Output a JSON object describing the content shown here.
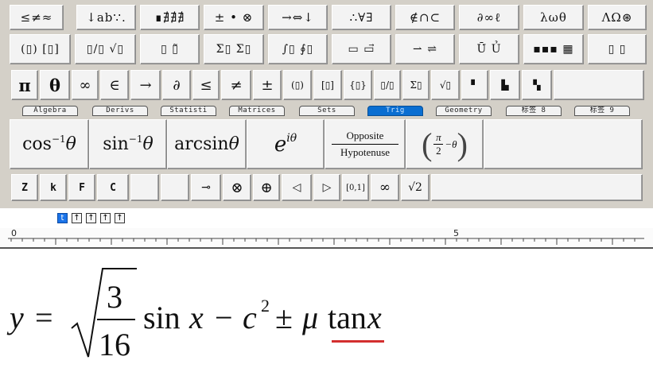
{
  "palettes": {
    "row1": [
      "≤≠≈",
      "↓ab∵.",
      "∎∄∄∄",
      "± • ⊗",
      "→⇔↓",
      "∴∀∃",
      "∉∩⊂",
      "∂∞ℓ",
      "λωθ",
      "ΛΩ⊛"
    ],
    "row2": [
      "(▯) [▯]",
      "▯/▯ √▯",
      "▯ ▯̃",
      "Σ▯ Σ▯",
      "∫▯ ∮▯",
      "▭ ▭⃗",
      "⇀ ⇌",
      "Ū̇ Ủ",
      "▪▪▪ ▦",
      "▯ ▯"
    ],
    "row3": [
      "π",
      "θ",
      "∞",
      "∈",
      "→",
      "∂",
      "≤",
      "≠",
      "±",
      "(▯)",
      "[▯]",
      "{▯}",
      "▯/▯",
      "Σ▯",
      "√▯",
      "▘",
      "▙",
      "▚"
    ]
  },
  "tabs": [
    "Algebra",
    "Derivs",
    "Statisti",
    "Matrices",
    "Sets",
    "Trig",
    "Geometry",
    "标签 8",
    "标签 9"
  ],
  "trig": {
    "cos_inv": "cos",
    "sin_inv": "sin",
    "inv_sup": "−1",
    "theta": "θ",
    "arcsin": "arcsin",
    "exp_base": "e",
    "exp_sup": "iθ",
    "ratio_top": "Opposite",
    "ratio_bottom": "Hypotenuse",
    "paren_pi": "π",
    "paren_two": "2",
    "paren_rest": "−θ"
  },
  "row5": [
    "Z",
    "k",
    "F",
    "C",
    "",
    "",
    "⊸",
    "⊗",
    "⊕",
    "◁",
    "▷",
    "[0,1]",
    "∞",
    "√2"
  ],
  "ruler": {
    "label_start": "0",
    "label_mid": "5"
  },
  "mini_buttons": [
    "t",
    "↑",
    "↑",
    "↑",
    "↑"
  ],
  "equation": {
    "lhs": "y",
    "equals": "=",
    "frac_num": "3",
    "frac_den": "16",
    "sin": "sin",
    "x1": "x",
    "minus": "−",
    "c": "c",
    "c_sup": "2",
    "pm": "±",
    "mu": "μ",
    "tan": "tan",
    "x2": "x"
  },
  "colors": {
    "active_tab": "#0a6ed1",
    "squiggle": "#d32f2f"
  }
}
